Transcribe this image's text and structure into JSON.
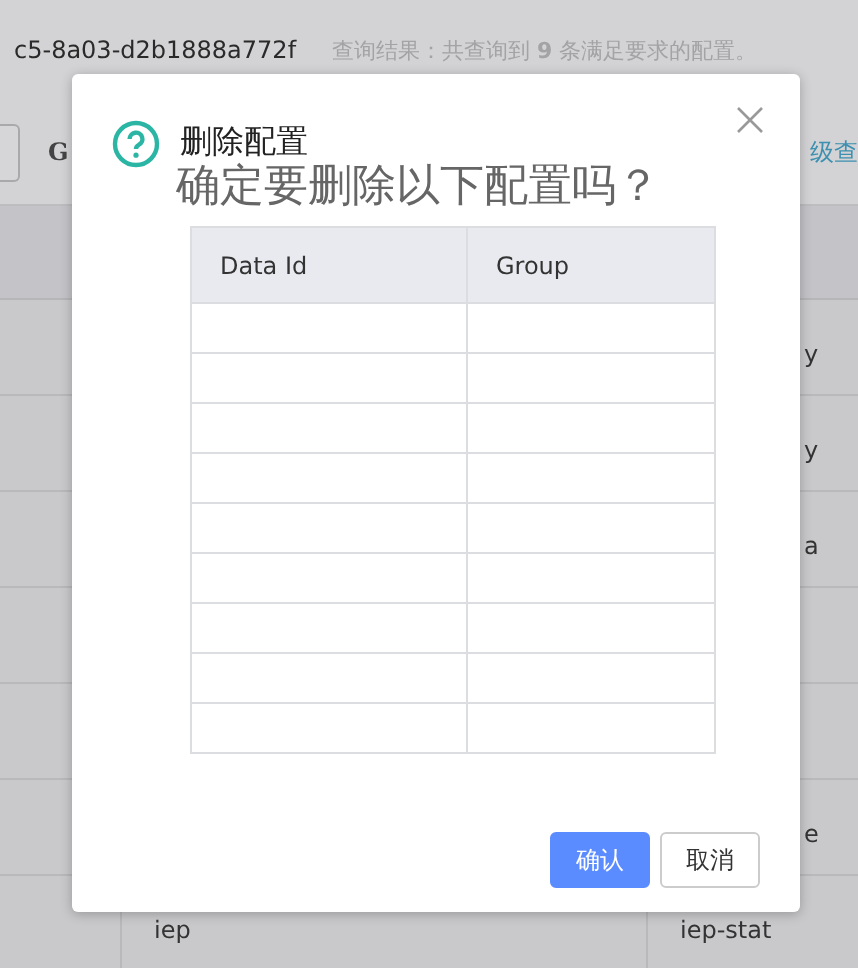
{
  "page": {
    "config_id": "c5-8a03-d2b1888a772f",
    "result_summary": "查询结果：共查询到 **9** 条满足要求的配置。",
    "search_label": "G",
    "advanced_link": "级查",
    "table": {
      "rows": [
        {
          "kind": "tail",
          "column_3": "y"
        },
        {
          "kind": "tail",
          "column_3": "y"
        },
        {
          "kind": "tail",
          "column_3": "a"
        },
        {
          "kind": "tail"
        },
        {
          "kind": "tail"
        },
        {
          "kind": "tail",
          "column_3": "e"
        },
        {
          "kind": "full",
          "column_2": "iep",
          "column_3": "iep-stat"
        }
      ]
    }
  },
  "dialog": {
    "title": "删除配置",
    "message": "确定要删除以下配置吗？",
    "table": {
      "columns": [
        "Data Id",
        "Group"
      ],
      "rows": [
        {},
        {},
        {},
        {},
        {},
        {},
        {},
        {},
        {}
      ]
    },
    "buttons": [
      {
        "label": "确认",
        "kind": "primary"
      },
      {
        "label": "取消",
        "kind": "default"
      }
    ]
  }
}
